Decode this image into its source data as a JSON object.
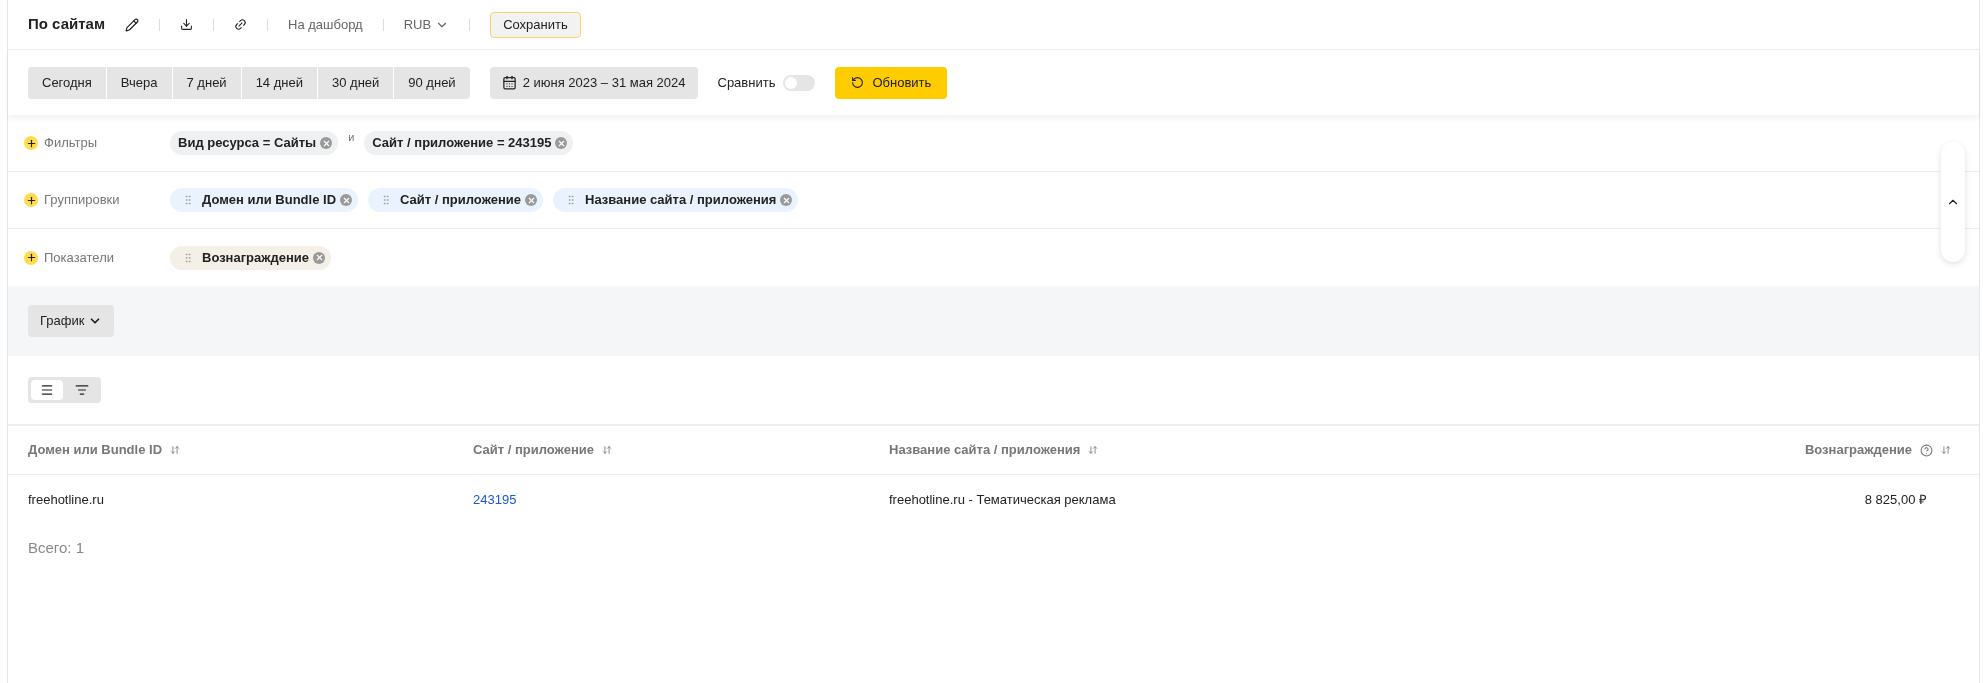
{
  "header": {
    "title": "По сайтам",
    "dashboard_link": "На дашборд",
    "currency": "RUB",
    "save_button": "Сохранить"
  },
  "periods": [
    {
      "label": "Сегодня",
      "selected": false
    },
    {
      "label": "Вчера",
      "selected": false
    },
    {
      "label": "7 дней",
      "selected": false
    },
    {
      "label": "14 дней",
      "selected": false
    },
    {
      "label": "30 дней",
      "selected": false
    },
    {
      "label": "90 дней",
      "selected": false
    }
  ],
  "date_range": "2 июня 2023 – 31 мая 2024",
  "compare": {
    "label": "Сравнить",
    "on": false
  },
  "refresh_button": "Обновить",
  "sections": [
    {
      "kind": "filter",
      "label": "Фильтры",
      "connector": "и",
      "chips": [
        "Вид ресурса = Сайты",
        "Сайт / приложение = 243195"
      ]
    },
    {
      "kind": "grouping",
      "label": "Группировки",
      "chips": [
        "Домен или Bundle ID",
        "Сайт / приложение",
        "Название сайта / приложения"
      ]
    },
    {
      "kind": "metric",
      "label": "Показатели",
      "chips": [
        "Вознаграждение"
      ]
    }
  ],
  "panel": {
    "expanded": true
  },
  "chart_toggle": "График",
  "view_toggle": [
    {
      "kind": "list",
      "selected": true
    },
    {
      "kind": "tree",
      "selected": false
    }
  ],
  "table": {
    "columns": [
      {
        "label": "Домен или Bundle ID",
        "kind": "dimension"
      },
      {
        "label": "Сайт / приложение",
        "kind": "dimension"
      },
      {
        "label": "Название сайта / приложения",
        "kind": "dimension"
      },
      {
        "label": "Вознаграждение",
        "kind": "metric"
      }
    ],
    "rows": [
      [
        {
          "text": "freehotline.ru",
          "kind": "text"
        },
        {
          "text": "243195",
          "kind": "link"
        },
        {
          "text": "freehotline.ru - Тематическая реклама",
          "kind": "text"
        },
        {
          "text": "8 825,00 ₽",
          "kind": "text"
        }
      ]
    ],
    "total": "Всего: 1"
  }
}
